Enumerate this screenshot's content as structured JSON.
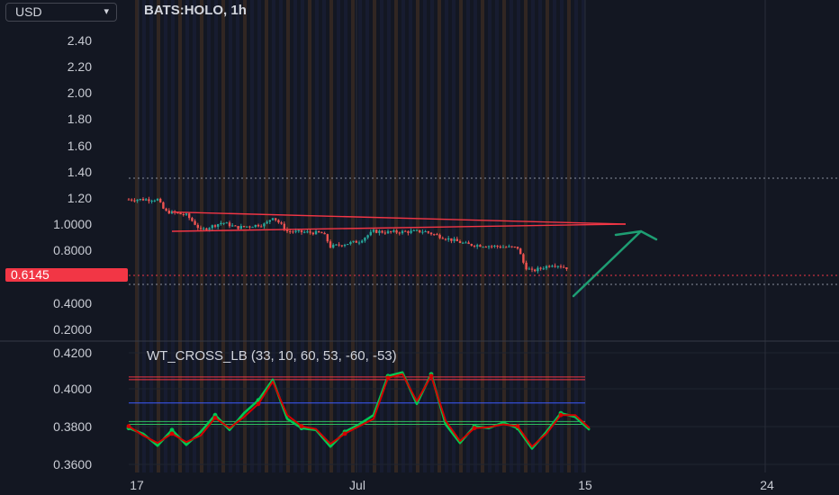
{
  "header": {
    "currency": "USD",
    "symbol": "BATS:HOLO, 1h"
  },
  "last_price": "0.6145",
  "indicator": {
    "title": "WT_CROSS_LB (33, 10, 60, 53, -60, -53)"
  },
  "icons": [
    "chevron-down-icon",
    "up-arrow-annotation"
  ],
  "colors": {
    "background": "#131722",
    "up": "#26a69a",
    "down": "#ef5350",
    "price_tag": "#f23645",
    "arrow": "#1e9e73",
    "trendline": "#f23645",
    "wt1": "#00c853",
    "wt2": "#d50000",
    "ob_line": "#f23645",
    "os_line": "#2ebd5f"
  },
  "chart_data": [
    {
      "type": "candlestick",
      "title": "BATS:HOLO, 1h",
      "yscale": "log",
      "y_ticks": [
        "2.40",
        "2.20",
        "2.00",
        "1.80",
        "1.60",
        "1.40",
        "1.20",
        "1.0000",
        "0.8000",
        "0.6145",
        "0.4000",
        "0.2000"
      ],
      "x_ticks": [
        "17",
        "Jul",
        "15",
        "24"
      ],
      "price_path": [
        {
          "t": 0,
          "p": 1.33
        },
        {
          "t": 4,
          "p": 1.33
        },
        {
          "t": 5,
          "p": 1.16
        },
        {
          "t": 8,
          "p": 1.11
        },
        {
          "t": 10,
          "p": 0.93
        },
        {
          "t": 13,
          "p": 1.02
        },
        {
          "t": 15,
          "p": 0.96
        },
        {
          "t": 17,
          "p": 0.98
        },
        {
          "t": 19,
          "p": 1.0
        },
        {
          "t": 20,
          "p": 1.09
        },
        {
          "t": 22,
          "p": 0.92
        },
        {
          "t": 27,
          "p": 0.9
        },
        {
          "t": 28,
          "p": 0.77
        },
        {
          "t": 32,
          "p": 0.82
        },
        {
          "t": 34,
          "p": 0.92
        },
        {
          "t": 36,
          "p": 0.91
        },
        {
          "t": 41,
          "p": 0.92
        },
        {
          "t": 44,
          "p": 0.85
        },
        {
          "t": 47,
          "p": 0.79
        },
        {
          "t": 54,
          "p": 0.76
        },
        {
          "t": 55,
          "p": 0.61
        },
        {
          "t": 56,
          "p": 0.58
        },
        {
          "t": 59,
          "p": 0.63
        },
        {
          "t": 61,
          "p": 0.6
        }
      ],
      "trendlines": [
        {
          "from": {
            "t": 6,
            "p": 1.15
          },
          "to": {
            "t": 69,
            "p": 1.0
          }
        },
        {
          "from": {
            "t": 6,
            "p": 0.92
          },
          "to": {
            "t": 69,
            "p": 1.0
          }
        }
      ],
      "annotation": "up-arrow",
      "horizontal_lines": [
        1.36,
        0.6145,
        0.545
      ]
    },
    {
      "type": "line",
      "title": "WT_CROSS_LB (33, 10, 60, 53, -60, -53)",
      "y_ticks": [
        "0.4200",
        "0.4000",
        "0.3800",
        "0.3600"
      ],
      "levels": {
        "ob1": 0.406,
        "ob2": 0.4075,
        "os1": 0.3835,
        "os2": 0.382,
        "mid": 0.3935
      },
      "series": [
        {
          "color": "#00c853",
          "values": [
            {
              "t": 0,
              "v": 0.38
            },
            {
              "t": 2,
              "v": 0.377
            },
            {
              "t": 4,
              "v": 0.3705
            },
            {
              "t": 6,
              "v": 0.379
            },
            {
              "t": 8,
              "v": 0.371
            },
            {
              "t": 10,
              "v": 0.378
            },
            {
              "t": 12,
              "v": 0.387
            },
            {
              "t": 14,
              "v": 0.379
            },
            {
              "t": 16,
              "v": 0.388
            },
            {
              "t": 18,
              "v": 0.395
            },
            {
              "t": 20,
              "v": 0.406
            },
            {
              "t": 22,
              "v": 0.385
            },
            {
              "t": 24,
              "v": 0.38
            },
            {
              "t": 26,
              "v": 0.379
            },
            {
              "t": 28,
              "v": 0.37
            },
            {
              "t": 30,
              "v": 0.378
            },
            {
              "t": 32,
              "v": 0.382
            },
            {
              "t": 34,
              "v": 0.387
            },
            {
              "t": 36,
              "v": 0.408
            },
            {
              "t": 38,
              "v": 0.41
            },
            {
              "t": 40,
              "v": 0.393
            },
            {
              "t": 42,
              "v": 0.409
            },
            {
              "t": 44,
              "v": 0.382
            },
            {
              "t": 46,
              "v": 0.372
            },
            {
              "t": 48,
              "v": 0.381
            },
            {
              "t": 50,
              "v": 0.38
            },
            {
              "t": 52,
              "v": 0.383
            },
            {
              "t": 54,
              "v": 0.38
            },
            {
              "t": 56,
              "v": 0.369
            },
            {
              "t": 58,
              "v": 0.378
            },
            {
              "t": 60,
              "v": 0.388
            },
            {
              "t": 62,
              "v": 0.386
            },
            {
              "t": 64,
              "v": 0.379
            }
          ]
        },
        {
          "color": "#d50000",
          "values": [
            {
              "t": 0,
              "v": 0.381
            },
            {
              "t": 2,
              "v": 0.376
            },
            {
              "t": 4,
              "v": 0.372
            },
            {
              "t": 6,
              "v": 0.377
            },
            {
              "t": 8,
              "v": 0.3725
            },
            {
              "t": 10,
              "v": 0.376
            },
            {
              "t": 12,
              "v": 0.3855
            },
            {
              "t": 14,
              "v": 0.38
            },
            {
              "t": 16,
              "v": 0.386
            },
            {
              "t": 18,
              "v": 0.393
            },
            {
              "t": 20,
              "v": 0.405
            },
            {
              "t": 22,
              "v": 0.387
            },
            {
              "t": 24,
              "v": 0.381
            },
            {
              "t": 26,
              "v": 0.3795
            },
            {
              "t": 28,
              "v": 0.3715
            },
            {
              "t": 30,
              "v": 0.377
            },
            {
              "t": 32,
              "v": 0.381
            },
            {
              "t": 34,
              "v": 0.385
            },
            {
              "t": 36,
              "v": 0.407
            },
            {
              "t": 38,
              "v": 0.409
            },
            {
              "t": 40,
              "v": 0.3945
            },
            {
              "t": 42,
              "v": 0.408
            },
            {
              "t": 44,
              "v": 0.384
            },
            {
              "t": 46,
              "v": 0.373
            },
            {
              "t": 48,
              "v": 0.38
            },
            {
              "t": 50,
              "v": 0.3805
            },
            {
              "t": 52,
              "v": 0.382
            },
            {
              "t": 54,
              "v": 0.381
            },
            {
              "t": 56,
              "v": 0.37
            },
            {
              "t": 58,
              "v": 0.377
            },
            {
              "t": 60,
              "v": 0.387
            },
            {
              "t": 62,
              "v": 0.387
            },
            {
              "t": 64,
              "v": 0.38
            }
          ]
        }
      ]
    }
  ]
}
